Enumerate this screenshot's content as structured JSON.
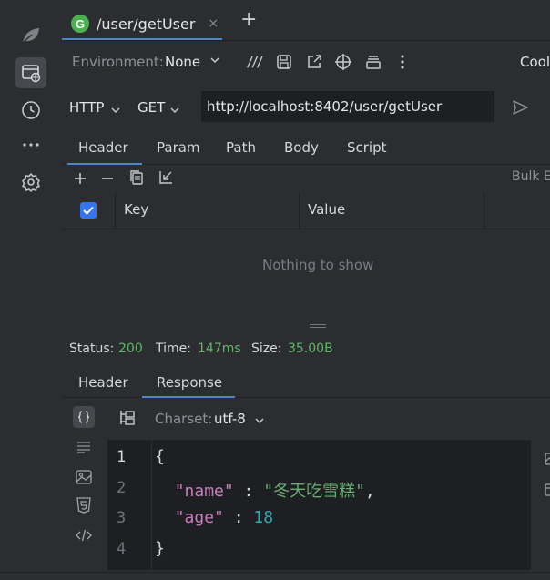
{
  "tab": {
    "icon_letter": "G",
    "title": "/user/getUser",
    "close": "×",
    "new": "+"
  },
  "environment": {
    "label": "Environment:",
    "value": "None"
  },
  "toolbar": {
    "cookies": "Cool"
  },
  "request": {
    "protocol": "HTTP",
    "method": "GET",
    "url": "http://localhost:8402/user/getUser"
  },
  "request_tabs": [
    "Header",
    "Param",
    "Path",
    "Body",
    "Script"
  ],
  "params_toolbar": {
    "bulk": "Bulk E"
  },
  "table": {
    "col_key": "Key",
    "col_value": "Value",
    "empty": "Nothing to show"
  },
  "status": {
    "status_label": "Status:",
    "status_value": "200",
    "time_label": "Time:",
    "time_value": "147ms",
    "size_label": "Size:",
    "size_value": "35.00B"
  },
  "response_tabs": [
    "Header",
    "Response"
  ],
  "charset": {
    "label": "Charset:",
    "value": "utf-8"
  },
  "editor": {
    "line_numbers": [
      "1",
      "2",
      "3",
      "4"
    ],
    "open_brace": "{",
    "close_brace": "}",
    "line2_key": "\"name\"",
    "line2_sep": " : ",
    "line2_value": "\"冬天吃雪糕\"",
    "line2_comma": ",",
    "line3_key": "\"age\"",
    "line3_sep": " : ",
    "line3_value": "18"
  },
  "colors": {
    "accent": "#4a88c7",
    "status_green": "#5fb865",
    "checkbox": "#3574f0",
    "json_key": "#c77dbb",
    "json_string": "#6aab73",
    "json_number": "#2aacb8"
  }
}
